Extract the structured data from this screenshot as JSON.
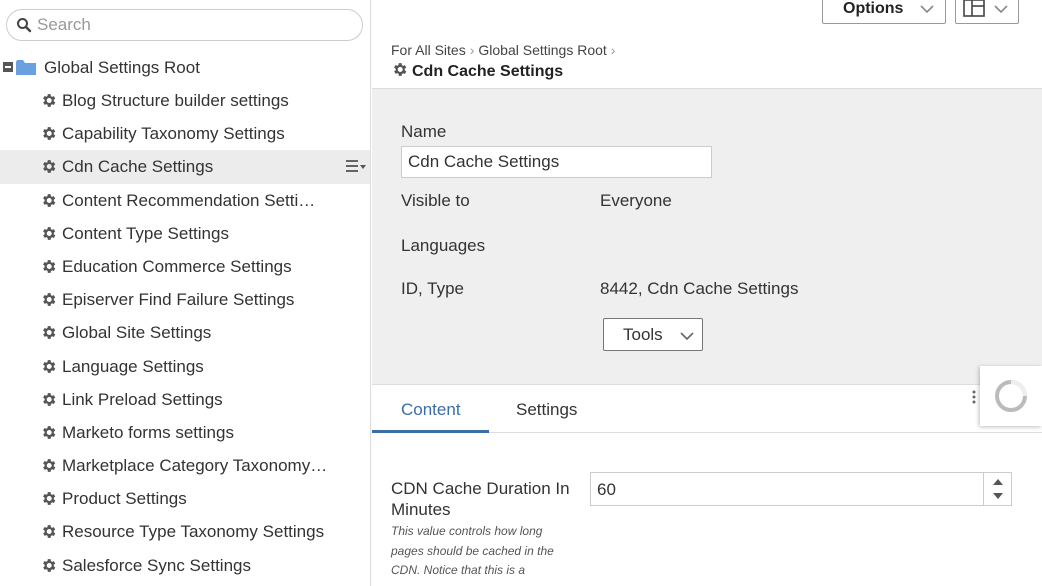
{
  "search": {
    "placeholder": "Search"
  },
  "tree": {
    "root_label": "Global Settings Root",
    "items": [
      {
        "label": "Blog Structure builder settings",
        "selected": false
      },
      {
        "label": "Capability Taxonomy Settings",
        "selected": false
      },
      {
        "label": "Cdn Cache Settings",
        "selected": true
      },
      {
        "label": "Content Recommendation Setti…",
        "selected": false
      },
      {
        "label": "Content Type Settings",
        "selected": false
      },
      {
        "label": "Education Commerce Settings",
        "selected": false
      },
      {
        "label": "Episerver Find Failure Settings",
        "selected": false
      },
      {
        "label": "Global Site Settings",
        "selected": false
      },
      {
        "label": "Language Settings",
        "selected": false
      },
      {
        "label": "Link Preload Settings",
        "selected": false
      },
      {
        "label": "Marketo forms settings",
        "selected": false
      },
      {
        "label": "Marketplace Category Taxonomy…",
        "selected": false
      },
      {
        "label": "Product Settings",
        "selected": false
      },
      {
        "label": "Resource Type Taxonomy Settings",
        "selected": false
      },
      {
        "label": "Salesforce Sync Settings",
        "selected": false
      }
    ]
  },
  "toolbar": {
    "options_label": "Options"
  },
  "breadcrumb": {
    "items": [
      "For All Sites",
      "Global Settings Root"
    ]
  },
  "page_title": "Cdn Cache Settings",
  "properties": {
    "name_label": "Name",
    "name_value": "Cdn Cache Settings",
    "visible_label": "Visible to",
    "visible_value": "Everyone",
    "languages_label": "Languages",
    "id_type_label": "ID, Type",
    "id_type_value": "8442, Cdn Cache Settings",
    "tools_label": "Tools"
  },
  "tabs": [
    {
      "label": "Content",
      "active": true
    },
    {
      "label": "Settings",
      "active": false
    }
  ],
  "field": {
    "label": "CDN Cache Duration In Minutes",
    "help": "This value controls how long pages should be cached in the CDN. Notice that this is a",
    "value": "60"
  },
  "colors": {
    "accent": "#3a6ea5",
    "folder": "#6aa0e0",
    "panel_bg": "#efefef",
    "selected_bg": "#ececec"
  }
}
